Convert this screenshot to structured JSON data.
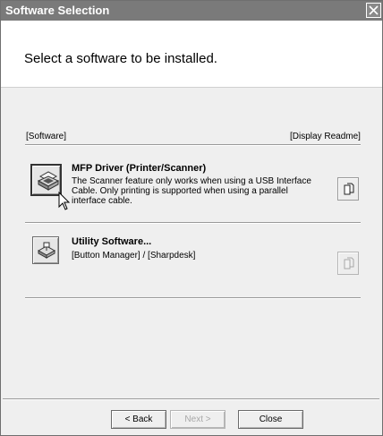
{
  "window": {
    "title": "Software Selection"
  },
  "header": {
    "heading": "Select a software to be installed."
  },
  "labels": {
    "software": "[Software]",
    "display_readme": "[Display Readme]"
  },
  "items": [
    {
      "title": "MFP Driver (Printer/Scanner)",
      "description_lines": [
        "The Scanner feature only works when using a USB Interface",
        "Cable. Only printing is supported when using a parallel",
        "interface cable."
      ]
    },
    {
      "title": "Utility Software...",
      "description_lines": [
        "[Button Manager] / [Sharpdesk]"
      ]
    }
  ],
  "footer": {
    "back": "< Back",
    "next": "Next >",
    "close": "Close"
  }
}
